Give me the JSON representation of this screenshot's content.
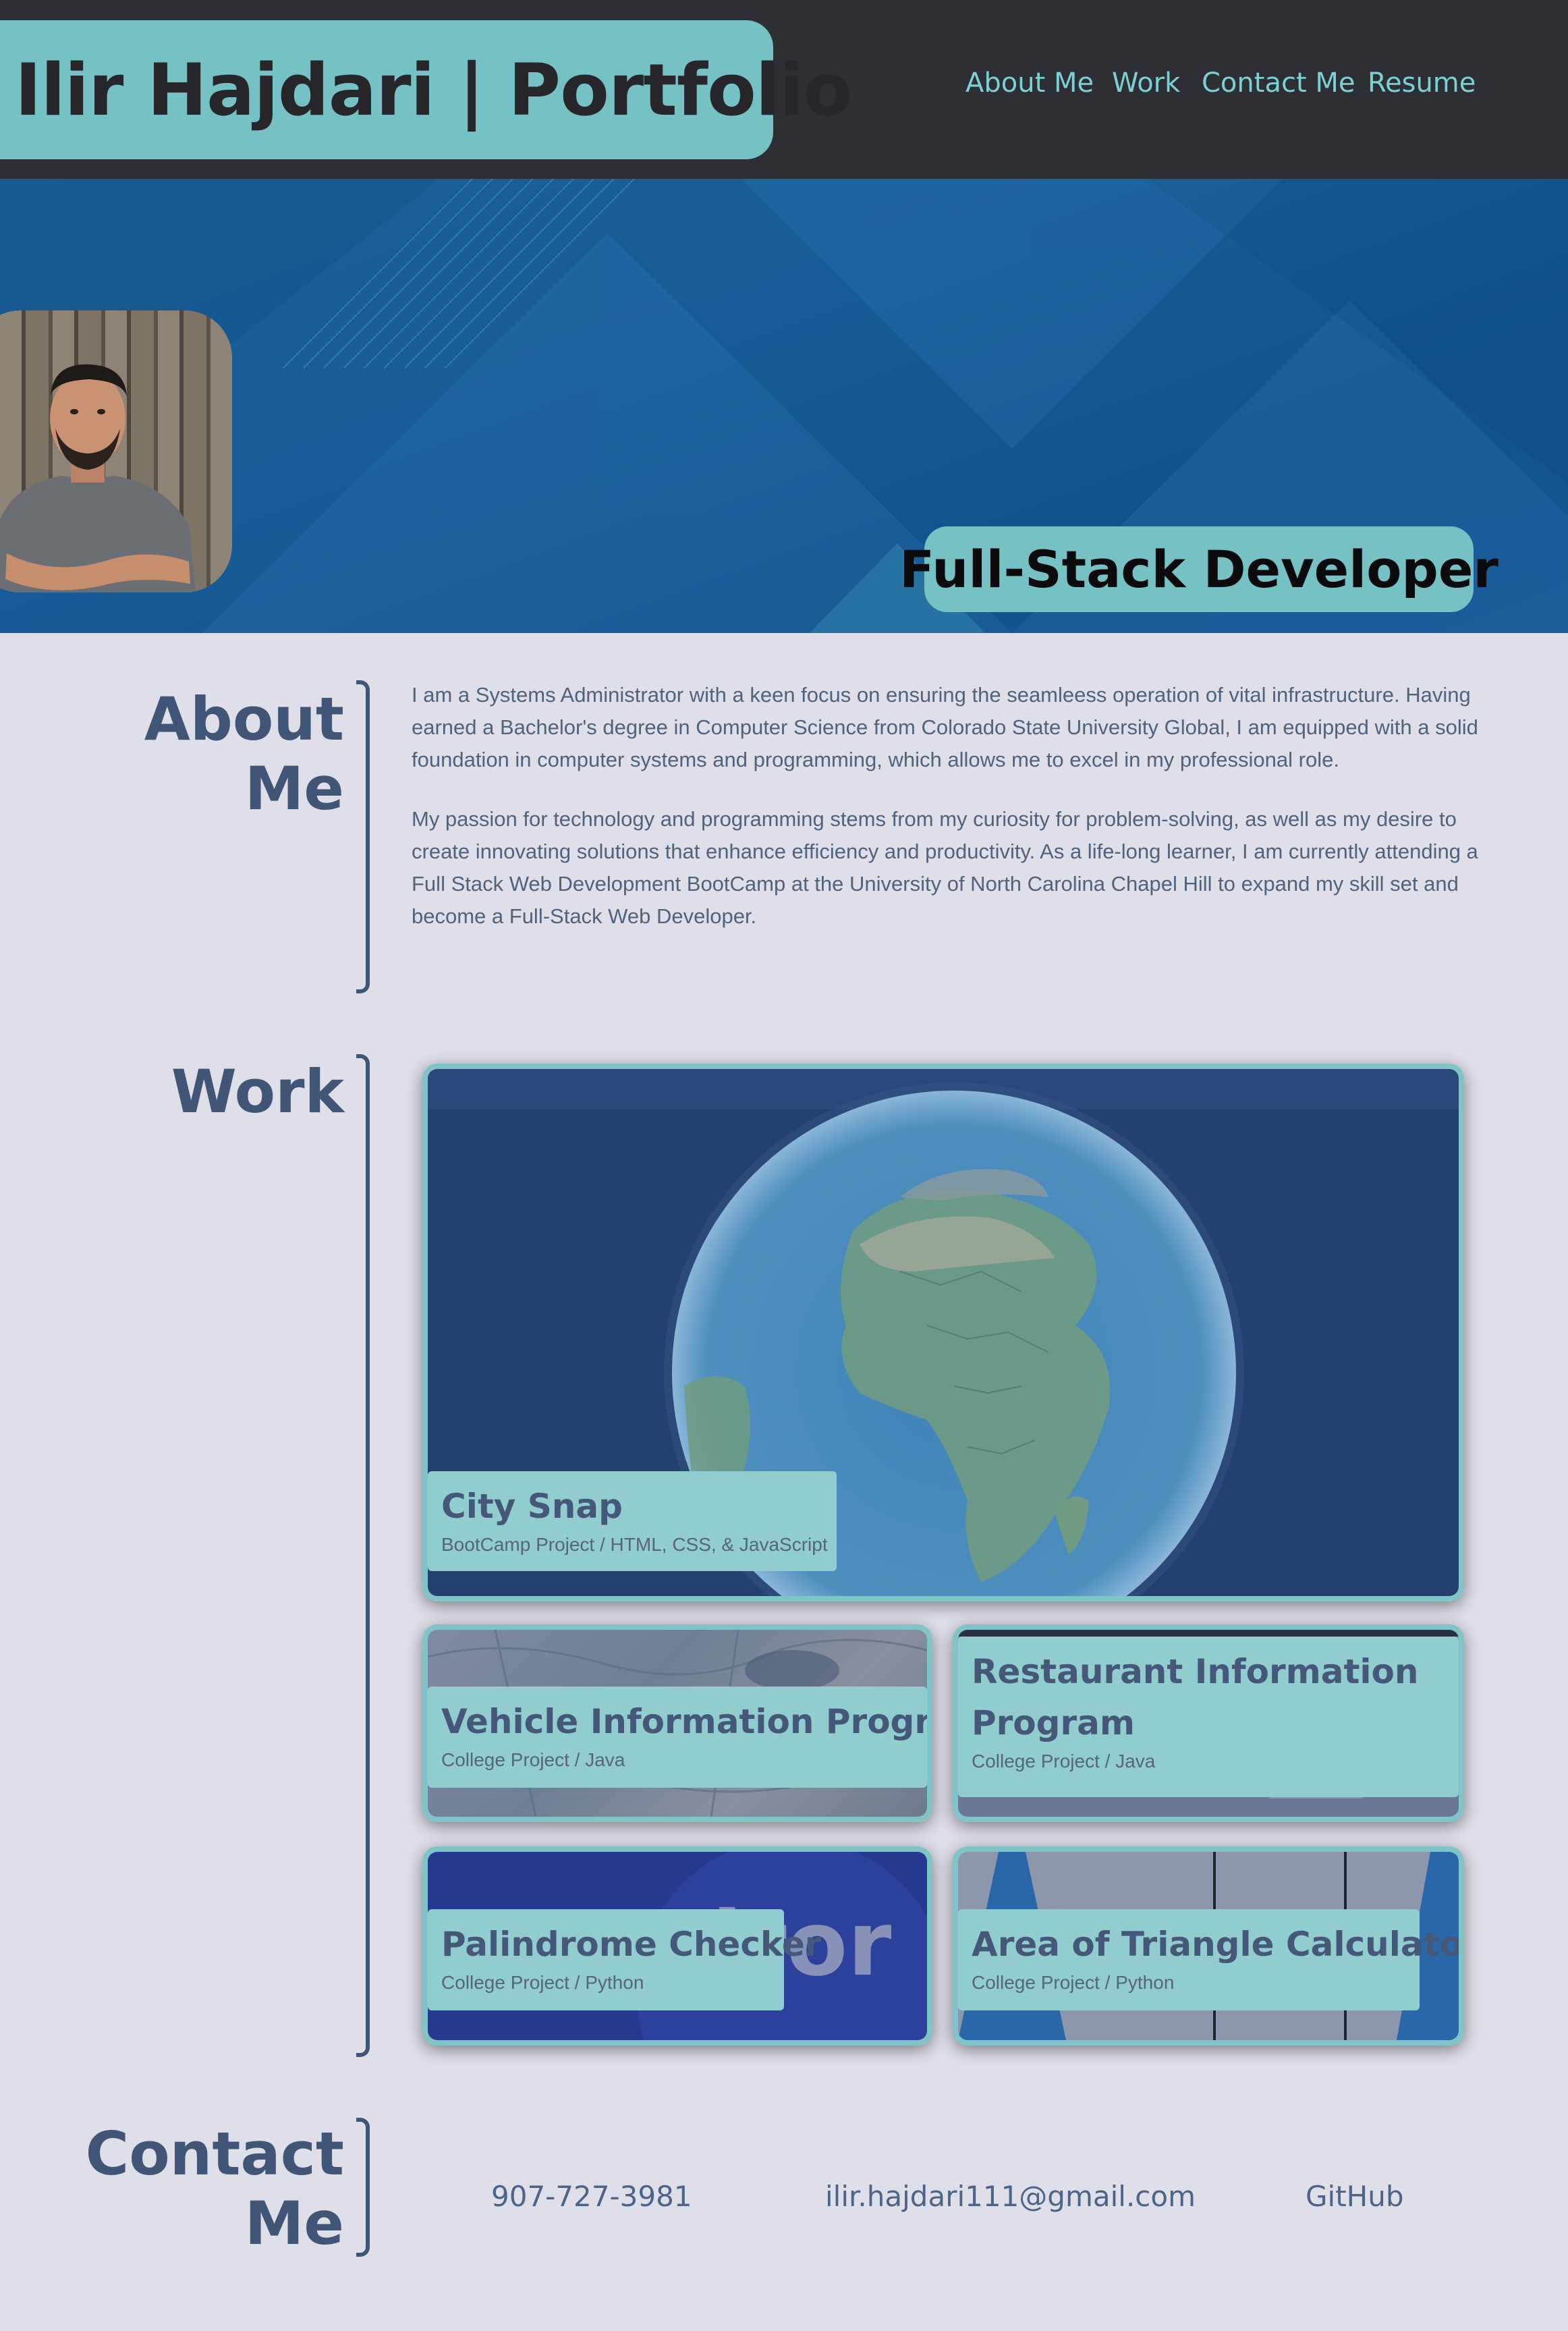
{
  "header": {
    "logo": "Ilir Hajdari | Portfolio",
    "nav": [
      {
        "label": "About Me"
      },
      {
        "label": "Work"
      },
      {
        "label": "Contact Me"
      },
      {
        "label": "Resume"
      }
    ]
  },
  "hero": {
    "title": "Full-Stack Developer"
  },
  "about": {
    "title_line1": "About",
    "title_line2": "Me",
    "paragraphs": [
      "I am a Systems Administrator with a keen focus on ensuring the seamleess operation of vital infrastructure. Having earned a Bachelor's degree in Computer Science from Colorado State University Global, I am equipped with a solid foundation in computer systems and programming, which allows me to excel in my professional role.",
      "My passion for technology and programming stems from my curiosity for problem-solving, as well as my desire to create innovating solutions that enhance efficiency and productivity. As a life-long learner, I am currently attending a Full Stack Web Development BootCamp at the University of North Carolina Chapel Hill to expand my skill set and become a Full-Stack Web Developer."
    ]
  },
  "work": {
    "title": "Work",
    "projects": [
      {
        "title": "City Snap",
        "subtitle": "BootCamp Project / HTML, CSS, & JavaScript"
      },
      {
        "title": "Vehicle Information Program",
        "subtitle": "College Project / Java"
      },
      {
        "title_line1": "Restaurant Information",
        "title_line2": "Program",
        "subtitle": "College Project / Java"
      },
      {
        "title": "Palindrome Checker",
        "subtitle": "College Project / Python",
        "bg_text": "dror"
      },
      {
        "title": "Area of Triangle Calculator",
        "subtitle": "College Project / Python"
      }
    ]
  },
  "contact": {
    "title_line1": "Contact",
    "title_line2": "Me",
    "phone": "907-727-3981",
    "email": "ilir.hajdari111@gmail.com",
    "github": "GitHub"
  },
  "colors": {
    "accent": "#76c1c3",
    "header_bg": "#2e2e35",
    "page_bg": "#dfdfe9",
    "heading": "#415677",
    "hero_blue": "#175c98"
  }
}
